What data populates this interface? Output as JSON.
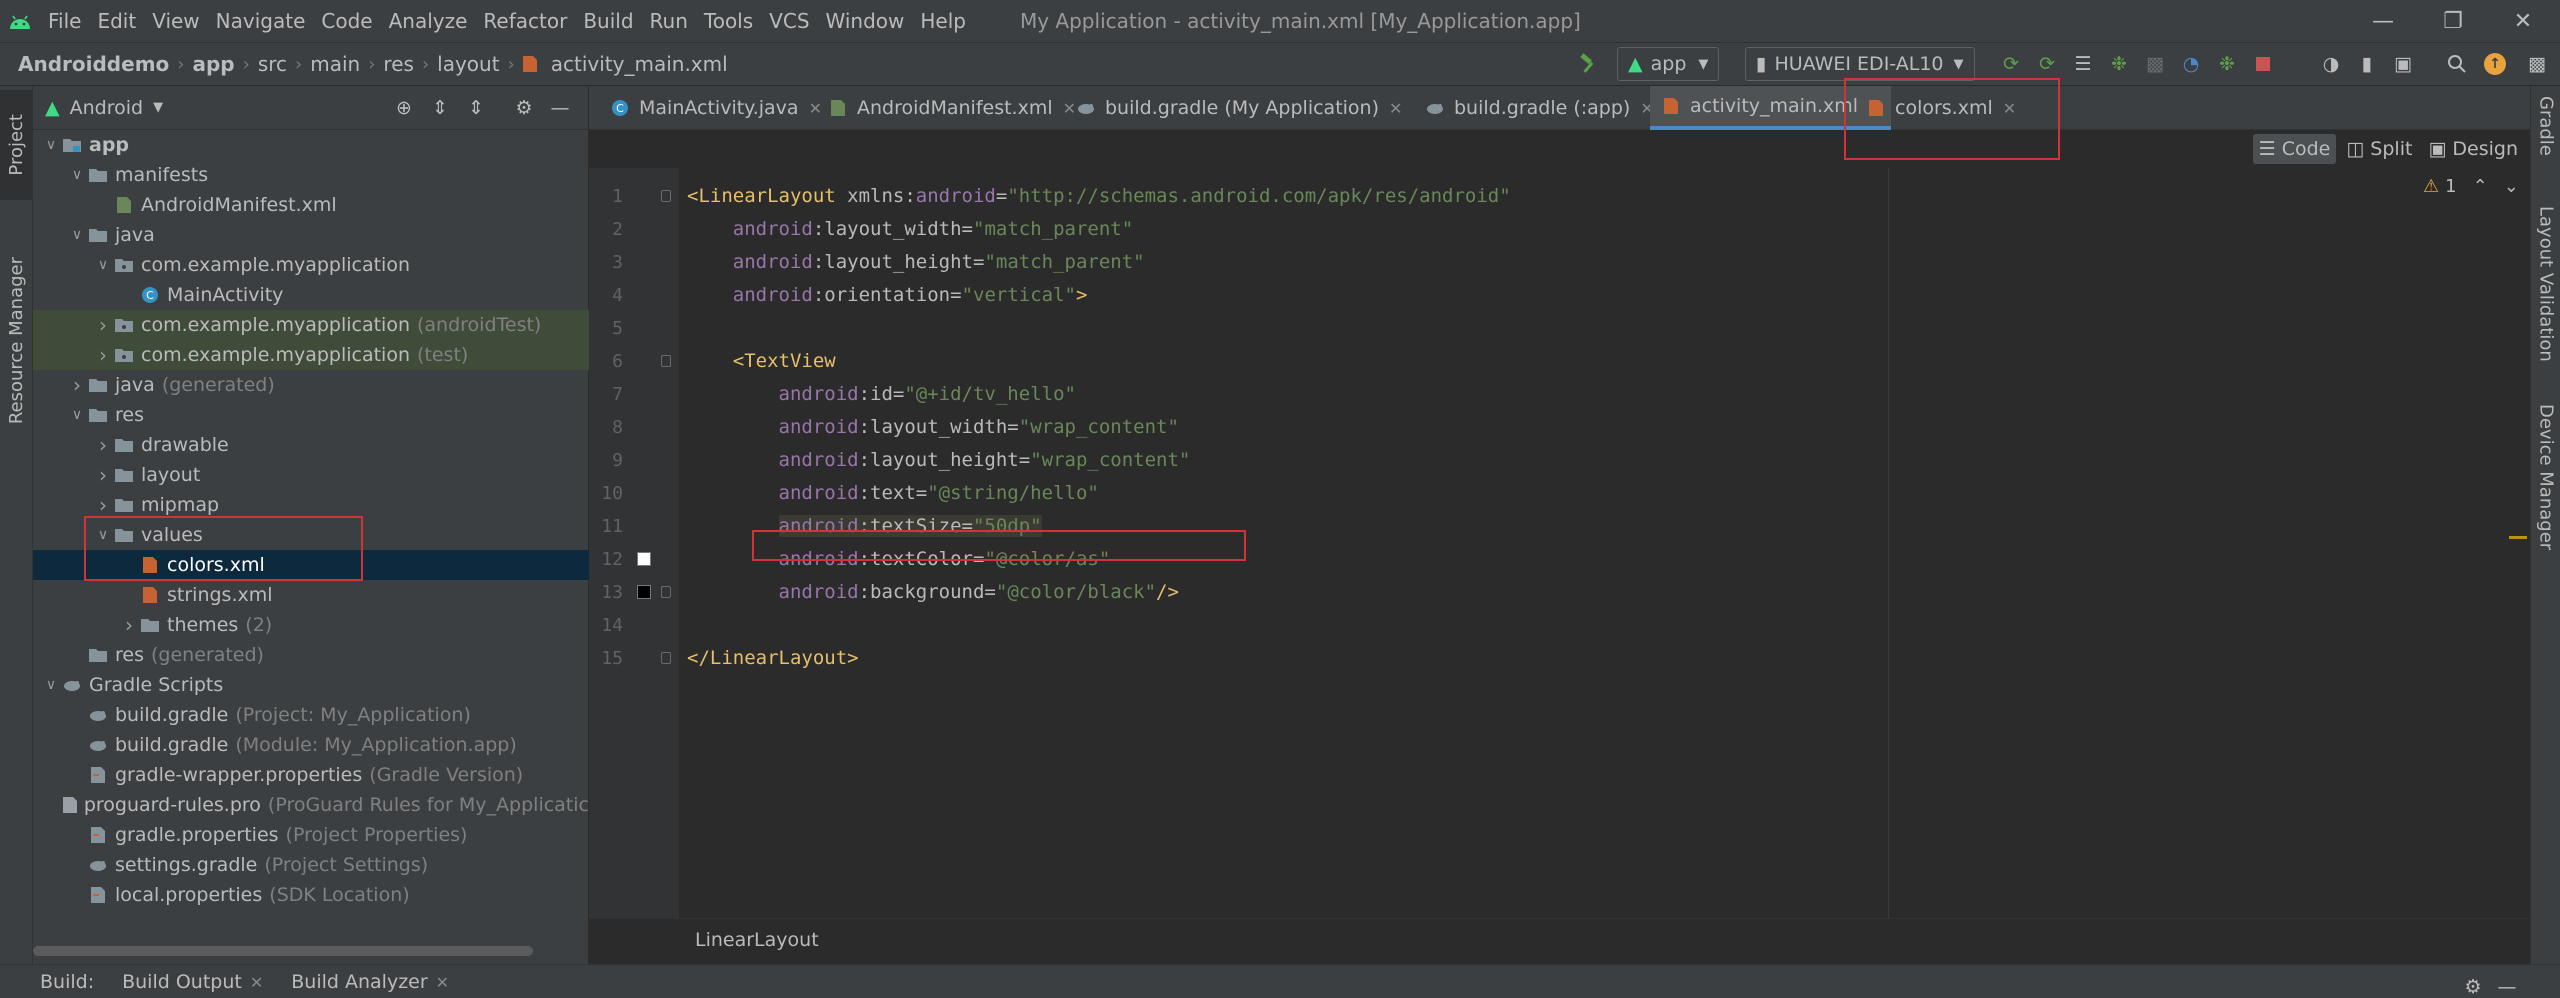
{
  "menubar": {
    "items": [
      "File",
      "Edit",
      "View",
      "Navigate",
      "Code",
      "Analyze",
      "Refactor",
      "Build",
      "Run",
      "Tools",
      "VCS",
      "Window",
      "Help"
    ],
    "title": "My Application - activity_main.xml [My_Application.app]"
  },
  "navbar": {
    "crumbs": [
      "Androiddemo",
      "app",
      "src",
      "main",
      "res",
      "layout",
      "activity_main.xml"
    ],
    "run_config": "app",
    "device": "HUAWEI EDI-AL10"
  },
  "left_strip": {
    "project": "Project",
    "resource_manager": "Resource Manager"
  },
  "right_strip": {
    "gradle": "Gradle",
    "layout_validation": "Layout Validation",
    "device_manager": "Device Manager"
  },
  "project": {
    "view": "Android",
    "tree": [
      {
        "label": "app",
        "hint": "",
        "depth": 0,
        "arrow": "open",
        "icon": "module-folder-icon",
        "bold": true,
        "state": ""
      },
      {
        "label": "manifests",
        "hint": "",
        "depth": 1,
        "arrow": "open",
        "icon": "folder-icon",
        "state": ""
      },
      {
        "label": "AndroidManifest.xml",
        "hint": "",
        "depth": 2,
        "arrow": "",
        "icon": "manifest-file-icon",
        "state": ""
      },
      {
        "label": "java",
        "hint": "",
        "depth": 1,
        "arrow": "open",
        "icon": "folder-icon",
        "state": ""
      },
      {
        "label": "com.example.myapplication",
        "hint": "",
        "depth": 2,
        "arrow": "open",
        "icon": "package-icon",
        "state": ""
      },
      {
        "label": "MainActivity",
        "hint": "",
        "depth": 3,
        "arrow": "",
        "icon": "class-icon",
        "state": ""
      },
      {
        "label": "com.example.myapplication",
        "hint": "(androidTest)",
        "depth": 2,
        "arrow": "closed",
        "icon": "package-icon",
        "state": "green"
      },
      {
        "label": "com.example.myapplication",
        "hint": "(test)",
        "depth": 2,
        "arrow": "closed",
        "icon": "package-icon",
        "state": "green"
      },
      {
        "label": "java",
        "hint": "(generated)",
        "depth": 1,
        "arrow": "closed",
        "icon": "folder-icon",
        "state": ""
      },
      {
        "label": "res",
        "hint": "",
        "depth": 1,
        "arrow": "open",
        "icon": "folder-icon",
        "state": ""
      },
      {
        "label": "drawable",
        "hint": "",
        "depth": 2,
        "arrow": "closed",
        "icon": "folder-icon",
        "state": ""
      },
      {
        "label": "layout",
        "hint": "",
        "depth": 2,
        "arrow": "closed",
        "icon": "folder-icon",
        "state": ""
      },
      {
        "label": "mipmap",
        "hint": "",
        "depth": 2,
        "arrow": "closed",
        "icon": "folder-icon",
        "state": ""
      },
      {
        "label": "values",
        "hint": "",
        "depth": 2,
        "arrow": "open",
        "icon": "folder-icon",
        "state": ""
      },
      {
        "label": "colors.xml",
        "hint": "",
        "depth": 3,
        "arrow": "",
        "icon": "xml-file-icon",
        "state": "sel"
      },
      {
        "label": "strings.xml",
        "hint": "",
        "depth": 3,
        "arrow": "",
        "icon": "xml-file-icon",
        "state": ""
      },
      {
        "label": "themes",
        "hint": "(2)",
        "depth": 3,
        "arrow": "closed",
        "icon": "folder-icon",
        "state": ""
      },
      {
        "label": "res",
        "hint": "(generated)",
        "depth": 1,
        "arrow": "",
        "icon": "folder-icon",
        "state": ""
      },
      {
        "label": "Gradle Scripts",
        "hint": "",
        "depth": 0,
        "arrow": "open",
        "icon": "gradle-icon",
        "state": ""
      },
      {
        "label": "build.gradle",
        "hint": "(Project: My_Application)",
        "depth": 1,
        "arrow": "",
        "icon": "gradle-icon",
        "state": ""
      },
      {
        "label": "build.gradle",
        "hint": "(Module: My_Application.app)",
        "depth": 1,
        "arrow": "",
        "icon": "gradle-icon",
        "state": ""
      },
      {
        "label": "gradle-wrapper.properties",
        "hint": "(Gradle Version)",
        "depth": 1,
        "arrow": "",
        "icon": "properties-icon",
        "state": ""
      },
      {
        "label": "proguard-rules.pro",
        "hint": "(ProGuard Rules for My_Applicatic",
        "depth": 1,
        "arrow": "",
        "icon": "text-file-icon",
        "state": ""
      },
      {
        "label": "gradle.properties",
        "hint": "(Project Properties)",
        "depth": 1,
        "arrow": "",
        "icon": "properties-icon",
        "state": ""
      },
      {
        "label": "settings.gradle",
        "hint": "(Project Settings)",
        "depth": 1,
        "arrow": "",
        "icon": "gradle-icon",
        "state": ""
      },
      {
        "label": "local.properties",
        "hint": "(SDK Location)",
        "depth": 1,
        "arrow": "",
        "icon": "properties-icon",
        "state": ""
      }
    ]
  },
  "editor": {
    "tabs": [
      {
        "label": "MainActivity.java",
        "icon": "class-icon"
      },
      {
        "label": "AndroidManifest.xml",
        "icon": "manifest-file-icon"
      },
      {
        "label": "build.gradle (My Application)",
        "icon": "gradle-icon"
      },
      {
        "label": "build.gradle (:app)",
        "icon": "gradle-icon"
      },
      {
        "label": "activity_main.xml",
        "icon": "xml-file-icon"
      },
      {
        "label": "colors.xml",
        "icon": "xml-file-icon"
      }
    ],
    "active_tab": "activity_main.xml",
    "modes": {
      "code": "Code",
      "split": "Split",
      "design": "Design"
    },
    "warnings": "1",
    "breadcrumb": "LinearLayout",
    "lines": [
      {
        "n": "1",
        "parts": [
          [
            "t",
            "<LinearLayout"
          ],
          [
            "a",
            " xmlns:"
          ],
          [
            "an",
            "android"
          ],
          [
            "a",
            "="
          ],
          [
            "v",
            "\"http://schemas.android.com/apk/res/android\""
          ]
        ]
      },
      {
        "n": "2",
        "parts": [
          [
            "a",
            "    "
          ],
          [
            "an",
            "android"
          ],
          [
            "a",
            ":layout_width="
          ],
          [
            "v",
            "\"match_parent\""
          ]
        ]
      },
      {
        "n": "3",
        "parts": [
          [
            "a",
            "    "
          ],
          [
            "an",
            "android"
          ],
          [
            "a",
            ":layout_height="
          ],
          [
            "v",
            "\"match_parent\""
          ]
        ]
      },
      {
        "n": "4",
        "parts": [
          [
            "a",
            "    "
          ],
          [
            "an",
            "android"
          ],
          [
            "a",
            ":orientation="
          ],
          [
            "v",
            "\"vertical\""
          ],
          [
            "t",
            ">"
          ]
        ]
      },
      {
        "n": "5",
        "parts": []
      },
      {
        "n": "6",
        "parts": [
          [
            "a",
            "    "
          ],
          [
            "t",
            "<TextView"
          ]
        ]
      },
      {
        "n": "7",
        "parts": [
          [
            "a",
            "        "
          ],
          [
            "an",
            "android"
          ],
          [
            "a",
            ":id="
          ],
          [
            "v",
            "\"@+id/tv_hello\""
          ]
        ]
      },
      {
        "n": "8",
        "parts": [
          [
            "a",
            "        "
          ],
          [
            "an",
            "android"
          ],
          [
            "a",
            ":layout_width="
          ],
          [
            "v",
            "\"wrap_content\""
          ]
        ]
      },
      {
        "n": "9",
        "parts": [
          [
            "a",
            "        "
          ],
          [
            "an",
            "android"
          ],
          [
            "a",
            ":layout_height="
          ],
          [
            "v",
            "\"wrap_content\""
          ]
        ]
      },
      {
        "n": "10",
        "parts": [
          [
            "a",
            "        "
          ],
          [
            "an",
            "android"
          ],
          [
            "a",
            ":text="
          ],
          [
            "v",
            "\"@string/hello\""
          ]
        ]
      },
      {
        "n": "11",
        "parts": [
          [
            "a",
            "        "
          ],
          [
            "an",
            "android"
          ],
          [
            "a",
            ":textSize="
          ],
          [
            "v",
            "\"50dp\""
          ]
        ]
      },
      {
        "n": "12",
        "parts": [
          [
            "a",
            "        "
          ],
          [
            "an",
            "android"
          ],
          [
            "a",
            ":textColor="
          ],
          [
            "v",
            "\"@color/as\""
          ]
        ]
      },
      {
        "n": "13",
        "parts": [
          [
            "a",
            "        "
          ],
          [
            "an",
            "android"
          ],
          [
            "a",
            ":background="
          ],
          [
            "v",
            "\"@color/black\""
          ],
          [
            "t",
            "/>"
          ]
        ]
      },
      {
        "n": "14",
        "parts": []
      },
      {
        "n": "15",
        "parts": [
          [
            "t",
            "</LinearLayout>"
          ]
        ]
      }
    ]
  },
  "bottom": {
    "build": "Build:",
    "build_output": "Build Output",
    "build_analyzer": "Build Analyzer"
  },
  "colors": {
    "accent": "#4a88c7",
    "highlight_box": "#d13438",
    "selection": "#0d293e",
    "test_row": "#3f4c3a"
  }
}
